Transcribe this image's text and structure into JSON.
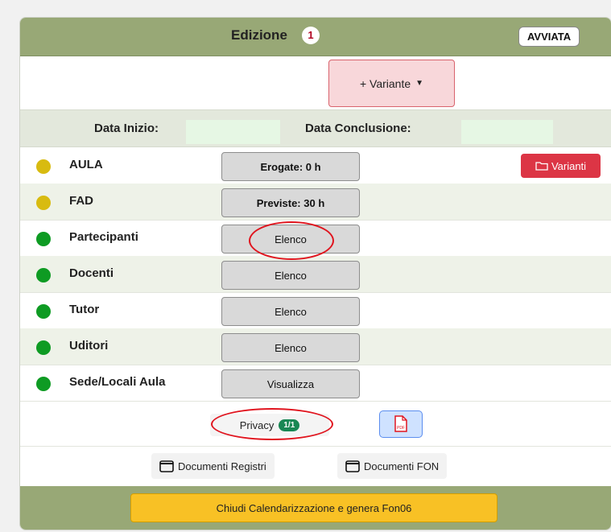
{
  "header": {
    "title": "Edizione",
    "badge": "1",
    "status": "AVVIATA"
  },
  "variante_button": {
    "label": "+ Variante"
  },
  "dates": {
    "start_label": "Data Inizio:",
    "start_value": "",
    "end_label": "Data Conclusione:",
    "end_value": ""
  },
  "rows": [
    {
      "label": "AULA",
      "status_color": "#d8bb10",
      "button": "Erogate: 0 h",
      "bold": true
    },
    {
      "label": "FAD",
      "status_color": "#d8bb10",
      "button": "Previste: 30 h",
      "bold": true
    },
    {
      "label": "Partecipanti",
      "status_color": "#0e9b23",
      "button": "Elenco"
    },
    {
      "label": "Docenti",
      "status_color": "#0e9b23",
      "button": "Elenco"
    },
    {
      "label": "Tutor",
      "status_color": "#0e9b23",
      "button": "Elenco"
    },
    {
      "label": "Uditori",
      "status_color": "#0e9b23",
      "button": "Elenco"
    },
    {
      "label": "Sede/Locali Aula",
      "status_color": "#0e9b23",
      "button": "Visualizza"
    }
  ],
  "varianti_button": {
    "label": "Varianti",
    "icon": "folder-icon"
  },
  "privacy": {
    "label": "Privacy",
    "badge": "1/1"
  },
  "pdf_button": {
    "icon": "pdf-icon",
    "text": "PDF"
  },
  "documents": [
    {
      "label": "Documenti Registri",
      "icon": "calendar-icon"
    },
    {
      "label": "Documenti FON",
      "icon": "calendar-icon"
    }
  ],
  "footer": {
    "button_label": "Chiudi Calendarizzazione e genera Fon06"
  },
  "colors": {
    "header": "#98a876",
    "warning": "#d8bb10",
    "success": "#0e9b23",
    "danger": "#dc3545",
    "yellow_button": "#f8c125"
  }
}
